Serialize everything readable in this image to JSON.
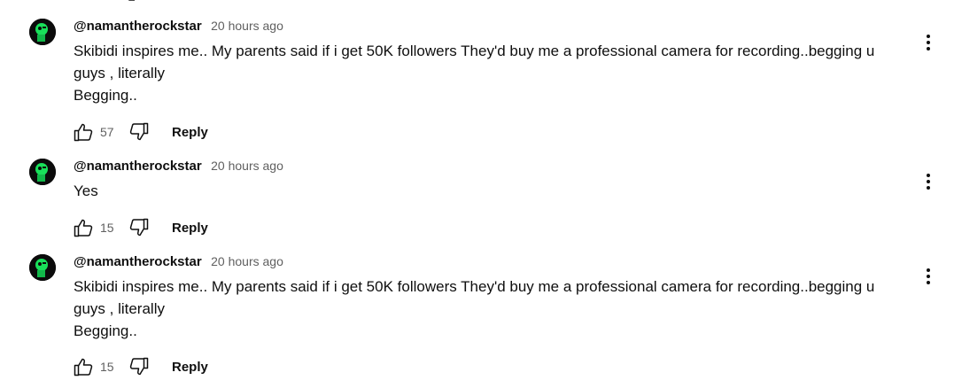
{
  "comments": [
    {
      "author": "@namantherockstar",
      "time": "20 hours ago",
      "lines": [
        "Skibidi inspires me.. My parents said if i get 50K followers They'd buy me a professional camera for recording..begging u",
        "guys , literally",
        "Begging.."
      ],
      "likes": "57",
      "reply_label": "Reply"
    },
    {
      "author": "@namantherockstar",
      "time": "20 hours ago",
      "lines": [
        "Yes"
      ],
      "likes": "15",
      "reply_label": "Reply"
    },
    {
      "author": "@namantherockstar",
      "time": "20 hours ago",
      "lines": [
        "Skibidi inspires me.. My parents said if i get 50K followers They'd buy me a professional camera for recording..begging u",
        "guys , literally",
        "Begging.."
      ],
      "likes": "15",
      "reply_label": "Reply"
    }
  ],
  "icons": {
    "like": "thumbs-up-icon",
    "dislike": "thumbs-down-icon",
    "menu": "more-vert-icon",
    "avatar_accent": "#19e05a"
  }
}
